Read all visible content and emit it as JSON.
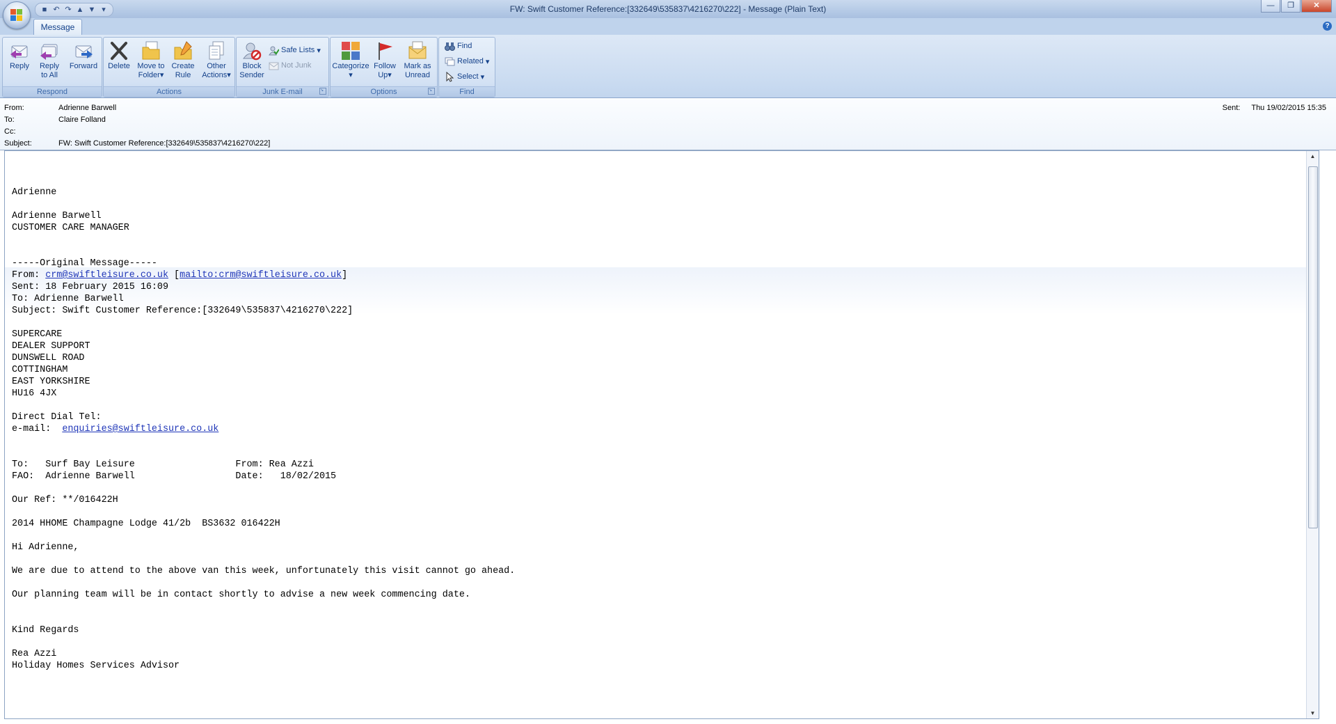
{
  "window": {
    "title": "FW: Swift Customer Reference:[332649\\535837\\4216270\\222] - Message (Plain Text)",
    "help_label": "?"
  },
  "ribbon": {
    "active_tab": "Message",
    "groups": {
      "respond": {
        "label": "Respond",
        "reply": "Reply",
        "reply_all_1": "Reply",
        "reply_all_2": "to All",
        "forward": "Forward"
      },
      "actions": {
        "label": "Actions",
        "delete": "Delete",
        "move_1": "Move to",
        "move_2": "Folder",
        "create_rule_1": "Create",
        "create_rule_2": "Rule",
        "other_1": "Other",
        "other_2": "Actions"
      },
      "junk": {
        "label": "Junk E-mail",
        "block_1": "Block",
        "block_2": "Sender",
        "safe_lists": "Safe Lists",
        "not_junk": "Not Junk"
      },
      "options": {
        "label": "Options",
        "categorize": "Categorize",
        "follow_1": "Follow",
        "follow_2": "Up",
        "mark_1": "Mark as",
        "mark_2": "Unread"
      },
      "find": {
        "label": "Find",
        "find": "Find",
        "related": "Related",
        "select": "Select"
      }
    }
  },
  "header": {
    "from_label": "From:",
    "from": "Adrienne Barwell",
    "to_label": "To:",
    "to": "Claire Folland",
    "cc_label": "Cc:",
    "cc": "",
    "subject_label": "Subject:",
    "subject": "FW: Swift Customer Reference:[332649\\535837\\4216270\\222]",
    "sent_label": "Sent:",
    "sent": "Thu 19/02/2015 15:35"
  },
  "body": {
    "l1": "Adrienne",
    "l2": "Adrienne Barwell",
    "l3": "CUSTOMER CARE MANAGER",
    "orig": "-----Original Message-----",
    "from_prefix": "From: ",
    "from_link": "crm@swiftleisure.co.uk",
    "from_mid": " [",
    "mailto_link": "mailto:crm@swiftleisure.co.uk",
    "from_suffix": "]",
    "sent": "Sent: 18 February 2015 16:09",
    "to": "To: Adrienne Barwell",
    "subject": "Subject: Swift Customer Reference:[332649\\535837\\4216270\\222]",
    "a1": "SUPERCARE",
    "a2": "DEALER SUPPORT",
    "a3": "DUNSWELL ROAD",
    "a4": "COTTINGHAM",
    "a5": "EAST YORKSHIRE",
    "a6": "HU16 4JX",
    "tel": "Direct Dial Tel:",
    "email_prefix": "e-mail:  ",
    "email_link": "enquiries@swiftleisure.co.uk",
    "to_line": "To:   Surf Bay Leisure                  From: Rea Azzi",
    "fao_line": "FAO:  Adrienne Barwell                  Date:   18/02/2015",
    "ref": "Our Ref: **/016422H",
    "van": "2014 HHOME Champagne Lodge 41/2b  BS3632 016422H",
    "greet": "Hi Adrienne,",
    "p1": "We are due to attend to the above van this week, unfortunately this visit cannot go ahead.",
    "p2": "Our planning team will be in contact shortly to advise a new week commencing date.",
    "regards": "Kind Regards",
    "sig1": "Rea Azzi",
    "sig2": "Holiday Homes Services Advisor"
  }
}
